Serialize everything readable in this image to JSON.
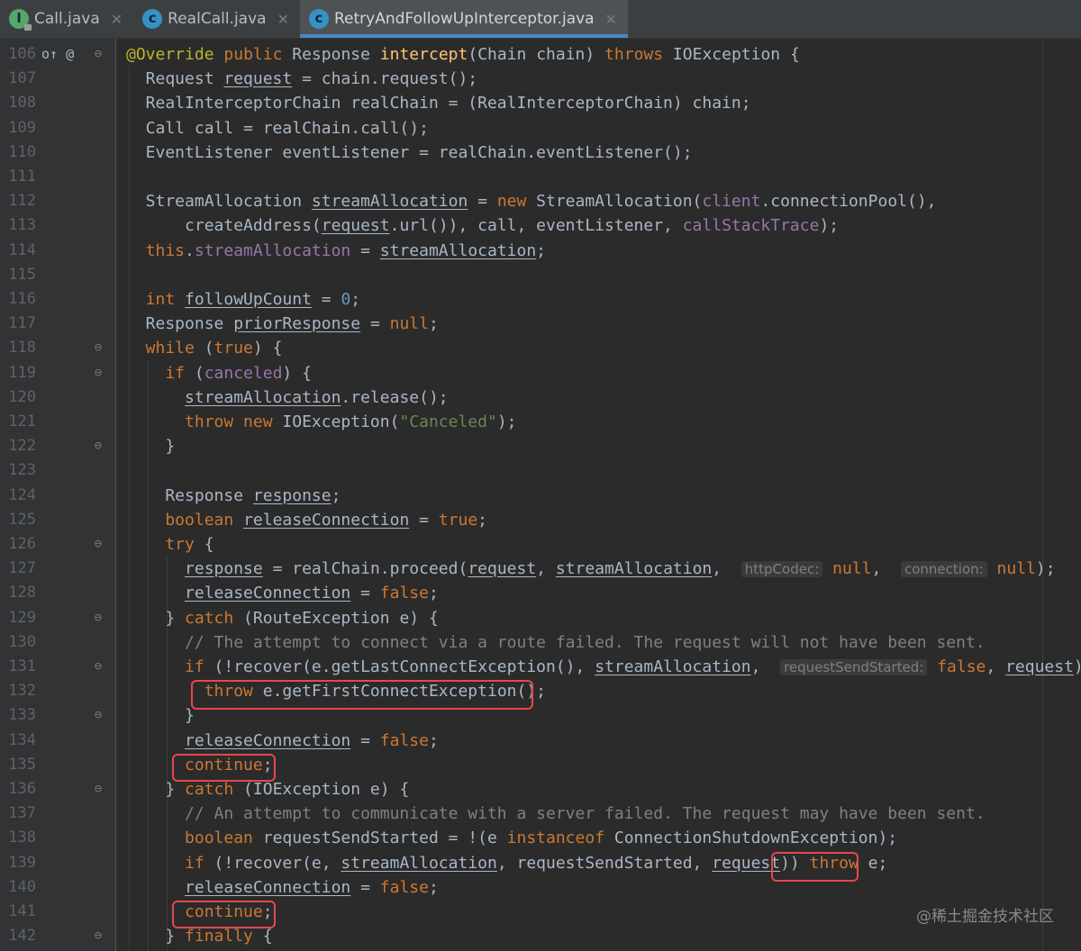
{
  "tabs": [
    {
      "label": "Call.java",
      "icon": "interface-file-icon",
      "active": false
    },
    {
      "label": "RealCall.java",
      "icon": "class-file-icon",
      "active": false
    },
    {
      "label": "RetryAndFollowUpInterceptor.java",
      "icon": "class-file-icon",
      "active": true
    }
  ],
  "tab_close_glyph": "✕",
  "watermark": "@稀土掘金技术社区",
  "colors": {
    "background": "#2b2b2b",
    "keyword": "#cc7832",
    "method": "#ffc66d",
    "field": "#9876aa",
    "string": "#6a8759",
    "number": "#6897bb",
    "comment": "#808080",
    "highlight_box": "#e5484d"
  },
  "lines": [
    {
      "n": "106",
      "gutter": "o↑ @",
      "fold": "⊖",
      "t": [
        [
          "an",
          "@Override"
        ],
        [
          "",
          " "
        ],
        [
          "kw",
          "public"
        ],
        [
          "",
          " Response "
        ],
        [
          "mt",
          "intercept"
        ],
        [
          "",
          "(Chain chain) "
        ],
        [
          "kw",
          "throws"
        ],
        [
          "",
          " IOException {"
        ]
      ]
    },
    {
      "n": "107",
      "gutter": "",
      "fold": "",
      "t": [
        [
          "",
          "  Request "
        ],
        [
          "u",
          "request"
        ],
        [
          "",
          " = chain.request();"
        ]
      ]
    },
    {
      "n": "108",
      "gutter": "",
      "fold": "",
      "t": [
        [
          "",
          "  RealInterceptorChain realChain = (RealInterceptorChain) chain;"
        ]
      ]
    },
    {
      "n": "109",
      "gutter": "",
      "fold": "",
      "t": [
        [
          "",
          "  Call call = realChain.call();"
        ]
      ]
    },
    {
      "n": "110",
      "gutter": "",
      "fold": "",
      "t": [
        [
          "",
          "  EventListener eventListener = realChain.eventListener();"
        ]
      ]
    },
    {
      "n": "111",
      "gutter": "",
      "fold": "",
      "t": []
    },
    {
      "n": "112",
      "gutter": "",
      "fold": "",
      "t": [
        [
          "",
          "  StreamAllocation "
        ],
        [
          "u",
          "streamAllocation"
        ],
        [
          "",
          " = "
        ],
        [
          "kw",
          "new"
        ],
        [
          "",
          " StreamAllocation("
        ],
        [
          "fd",
          "client"
        ],
        [
          "",
          ".connectionPool(),"
        ]
      ]
    },
    {
      "n": "113",
      "gutter": "",
      "fold": "",
      "t": [
        [
          "",
          "      createAddress("
        ],
        [
          "u",
          "request"
        ],
        [
          "",
          ".url()), call, eventListener, "
        ],
        [
          "fd",
          "callStackTrace"
        ],
        [
          "",
          ");"
        ]
      ]
    },
    {
      "n": "114",
      "gutter": "",
      "fold": "",
      "t": [
        [
          "kw",
          "  this"
        ],
        [
          "",
          "."
        ],
        [
          "fd",
          "streamAllocation"
        ],
        [
          "",
          " = "
        ],
        [
          "u",
          "streamAllocation"
        ],
        [
          "",
          ";"
        ]
      ]
    },
    {
      "n": "115",
      "gutter": "",
      "fold": "",
      "t": []
    },
    {
      "n": "116",
      "gutter": "",
      "fold": "",
      "t": [
        [
          "kw",
          "  int"
        ],
        [
          "",
          " "
        ],
        [
          "u",
          "followUpCount"
        ],
        [
          "",
          " = "
        ],
        [
          "nm",
          "0"
        ],
        [
          "",
          ";"
        ]
      ]
    },
    {
      "n": "117",
      "gutter": "",
      "fold": "",
      "t": [
        [
          "",
          "  Response "
        ],
        [
          "u",
          "priorResponse"
        ],
        [
          "",
          " = "
        ],
        [
          "kw",
          "null"
        ],
        [
          "",
          ";"
        ]
      ]
    },
    {
      "n": "118",
      "gutter": "",
      "fold": "⊖",
      "t": [
        [
          "kw",
          "  while"
        ],
        [
          "",
          " ("
        ],
        [
          "kw",
          "true"
        ],
        [
          "",
          ") {"
        ]
      ]
    },
    {
      "n": "119",
      "gutter": "",
      "fold": "⊖",
      "t": [
        [
          "kw",
          "    if"
        ],
        [
          "",
          " ("
        ],
        [
          "fd",
          "canceled"
        ],
        [
          "",
          ") {"
        ]
      ]
    },
    {
      "n": "120",
      "gutter": "",
      "fold": "",
      "t": [
        [
          "",
          "      "
        ],
        [
          "u",
          "streamAllocation"
        ],
        [
          "",
          ".release();"
        ]
      ]
    },
    {
      "n": "121",
      "gutter": "",
      "fold": "",
      "t": [
        [
          "kw",
          "      throw new"
        ],
        [
          "",
          " IOException("
        ],
        [
          "st",
          "\"Canceled\""
        ],
        [
          "",
          ");"
        ]
      ]
    },
    {
      "n": "122",
      "gutter": "",
      "fold": "⊖",
      "t": [
        [
          "",
          "    }"
        ]
      ]
    },
    {
      "n": "123",
      "gutter": "",
      "fold": "",
      "t": []
    },
    {
      "n": "124",
      "gutter": "",
      "fold": "",
      "t": [
        [
          "",
          "    Response "
        ],
        [
          "u",
          "response"
        ],
        [
          "",
          ";"
        ]
      ]
    },
    {
      "n": "125",
      "gutter": "",
      "fold": "",
      "t": [
        [
          "kw",
          "    boolean"
        ],
        [
          "",
          " "
        ],
        [
          "u",
          "releaseConnection"
        ],
        [
          "",
          " = "
        ],
        [
          "kw",
          "true"
        ],
        [
          "",
          ";"
        ]
      ]
    },
    {
      "n": "126",
      "gutter": "",
      "fold": "⊖",
      "t": [
        [
          "kw",
          "    try"
        ],
        [
          "",
          " {"
        ]
      ]
    },
    {
      "n": "127",
      "gutter": "",
      "fold": "",
      "t": [
        [
          "",
          "      "
        ],
        [
          "u",
          "response"
        ],
        [
          "",
          " = realChain.proceed("
        ],
        [
          "u",
          "request"
        ],
        [
          "",
          ", "
        ],
        [
          "u",
          "streamAllocation"
        ],
        [
          "",
          ",  "
        ],
        [
          "hint",
          "httpCodec:"
        ],
        [
          "",
          " "
        ],
        [
          "kw",
          "null"
        ],
        [
          "",
          ",  "
        ],
        [
          "hint",
          "connection:"
        ],
        [
          "",
          " "
        ],
        [
          "kw",
          "null"
        ],
        [
          "",
          ");"
        ]
      ]
    },
    {
      "n": "128",
      "gutter": "",
      "fold": "",
      "t": [
        [
          "",
          "      "
        ],
        [
          "u",
          "releaseConnection"
        ],
        [
          "",
          " = "
        ],
        [
          "kw",
          "false"
        ],
        [
          "",
          ";"
        ]
      ]
    },
    {
      "n": "129",
      "gutter": "",
      "fold": "⊖",
      "t": [
        [
          "",
          "    } "
        ],
        [
          "kw",
          "catch"
        ],
        [
          "",
          " (RouteException e) {"
        ]
      ]
    },
    {
      "n": "130",
      "gutter": "",
      "fold": "",
      "t": [
        [
          "cm",
          "      // The attempt to connect via a route failed. The request will not have been sent."
        ]
      ]
    },
    {
      "n": "131",
      "gutter": "",
      "fold": "⊖",
      "t": [
        [
          "kw",
          "      if"
        ],
        [
          "",
          " (!recover(e.getLastConnectException(), "
        ],
        [
          "u",
          "streamAllocation"
        ],
        [
          "",
          ",  "
        ],
        [
          "hint",
          "requestSendStarted:"
        ],
        [
          "",
          " "
        ],
        [
          "kw",
          "false"
        ],
        [
          "",
          ", "
        ],
        [
          "u",
          "request"
        ],
        [
          "",
          ")) {"
        ]
      ]
    },
    {
      "n": "132",
      "gutter": "",
      "fold": "",
      "t": [
        [
          "kw",
          "        throw"
        ],
        [
          "",
          " e.getFirstConnectException();"
        ]
      ]
    },
    {
      "n": "133",
      "gutter": "",
      "fold": "⊖",
      "t": [
        [
          "",
          "      }"
        ]
      ]
    },
    {
      "n": "134",
      "gutter": "",
      "fold": "",
      "t": [
        [
          "",
          "      "
        ],
        [
          "u",
          "releaseConnection"
        ],
        [
          "",
          " = "
        ],
        [
          "kw",
          "false"
        ],
        [
          "",
          ";"
        ]
      ]
    },
    {
      "n": "135",
      "gutter": "",
      "fold": "",
      "t": [
        [
          "kw",
          "      continue"
        ],
        [
          "",
          ";"
        ]
      ]
    },
    {
      "n": "136",
      "gutter": "",
      "fold": "⊖",
      "t": [
        [
          "",
          "    } "
        ],
        [
          "kw",
          "catch"
        ],
        [
          "",
          " (IOException e) {"
        ]
      ]
    },
    {
      "n": "137",
      "gutter": "",
      "fold": "",
      "t": [
        [
          "cm",
          "      // An attempt to communicate with a server failed. The request may have been sent."
        ]
      ]
    },
    {
      "n": "138",
      "gutter": "",
      "fold": "",
      "t": [
        [
          "kw",
          "      boolean"
        ],
        [
          "",
          " requestSendStarted = !(e "
        ],
        [
          "kw",
          "instanceof"
        ],
        [
          "",
          " ConnectionShutdownException);"
        ]
      ]
    },
    {
      "n": "139",
      "gutter": "",
      "fold": "",
      "t": [
        [
          "kw",
          "      if"
        ],
        [
          "",
          " (!recover(e, "
        ],
        [
          "u",
          "streamAllocation"
        ],
        [
          "",
          ", requestSendStarted, "
        ],
        [
          "u",
          "request"
        ],
        [
          "",
          ")) "
        ],
        [
          "kw",
          "throw"
        ],
        [
          "",
          " e;"
        ]
      ]
    },
    {
      "n": "140",
      "gutter": "",
      "fold": "",
      "t": [
        [
          "",
          "      "
        ],
        [
          "u",
          "releaseConnection"
        ],
        [
          "",
          " = "
        ],
        [
          "kw",
          "false"
        ],
        [
          "",
          ";"
        ]
      ]
    },
    {
      "n": "141",
      "gutter": "",
      "fold": "",
      "t": [
        [
          "kw",
          "      continue"
        ],
        [
          "",
          ";"
        ]
      ]
    },
    {
      "n": "142",
      "gutter": "",
      "fold": "⊖",
      "t": [
        [
          "",
          "    } "
        ],
        [
          "kw",
          "finally"
        ],
        [
          "",
          " {"
        ]
      ]
    }
  ]
}
